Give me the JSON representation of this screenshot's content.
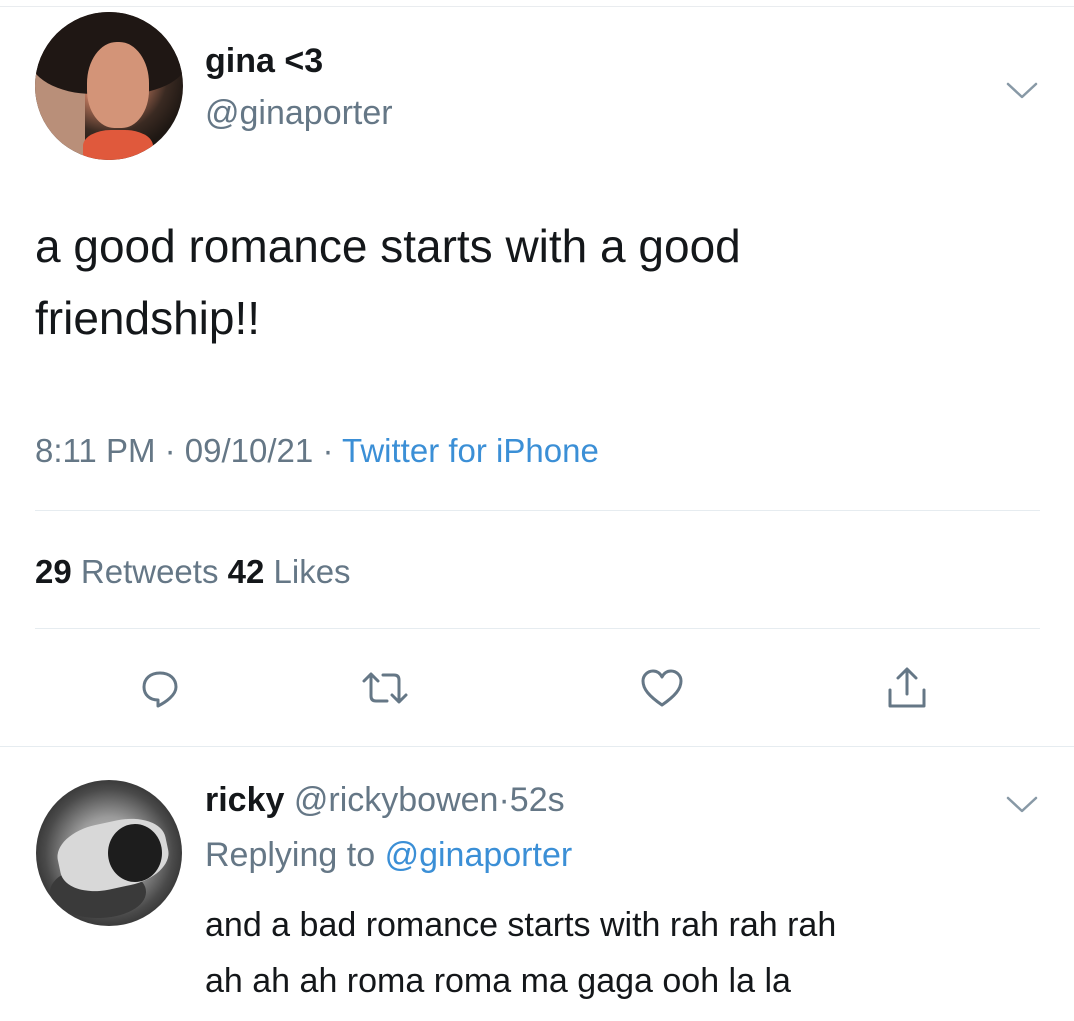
{
  "tweet": {
    "display_name": "gina <3",
    "handle": "@ginaporter",
    "text_line1": "a good romance starts with a good",
    "text_line2": "friendship!!",
    "time": "8:11 PM",
    "date": "09/10/21",
    "source": "Twitter for iPhone",
    "separator": "·",
    "retweets_count": "29",
    "retweets_label": "Retweets",
    "likes_count": "42",
    "likes_label": "Likes"
  },
  "actions": {
    "reply_icon": "speech-bubble-icon",
    "retweet_icon": "retweet-arrows-icon",
    "like_icon": "heart-icon",
    "share_icon": "share-upload-icon"
  },
  "reply": {
    "display_name": "ricky",
    "handle": "@rickybowen",
    "separator": "·",
    "age": "52s",
    "replying_prefix": "Replying to",
    "replying_to": "@ginaporter",
    "text_line1": "and a bad romance starts with rah rah rah",
    "text_line2": "ah ah ah roma roma ma gaga ooh la la"
  },
  "colors": {
    "text_primary": "#14171a",
    "text_secondary": "#657786",
    "link_blue": "#3b8fd6",
    "divider": "#e6ecf0"
  }
}
